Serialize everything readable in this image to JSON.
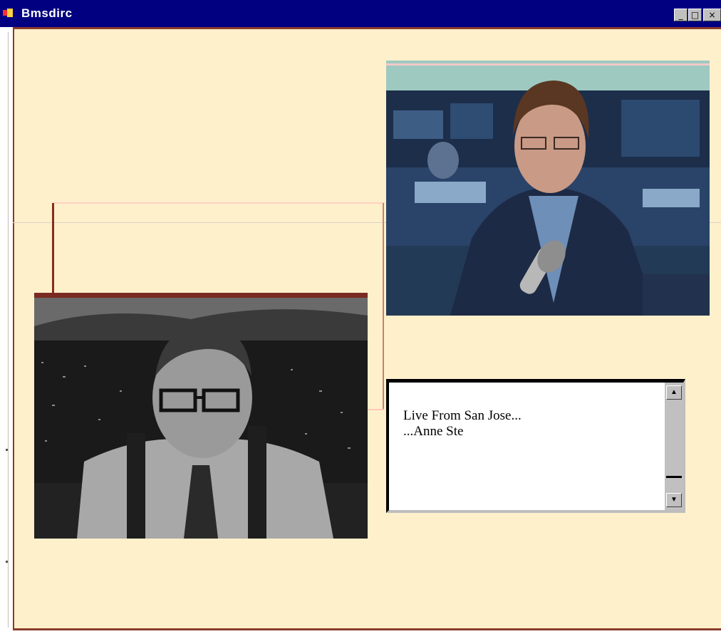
{
  "window": {
    "title": "Bmsdirc",
    "buttons": {
      "minimize": "_",
      "maximize": "□",
      "close": "×"
    }
  },
  "videos": {
    "right": {
      "label": "news anchor in newsroom"
    },
    "left": {
      "label": "host with glasses and suspenders"
    }
  },
  "caption": {
    "text": "Live From San Jose...\n...Anne Ste"
  },
  "scrollbar": {
    "up": "▲",
    "down": "▼"
  },
  "colors": {
    "titlebar": "#000080",
    "client_background": "#fff0cc",
    "frame_border": "#8a3a2a"
  }
}
